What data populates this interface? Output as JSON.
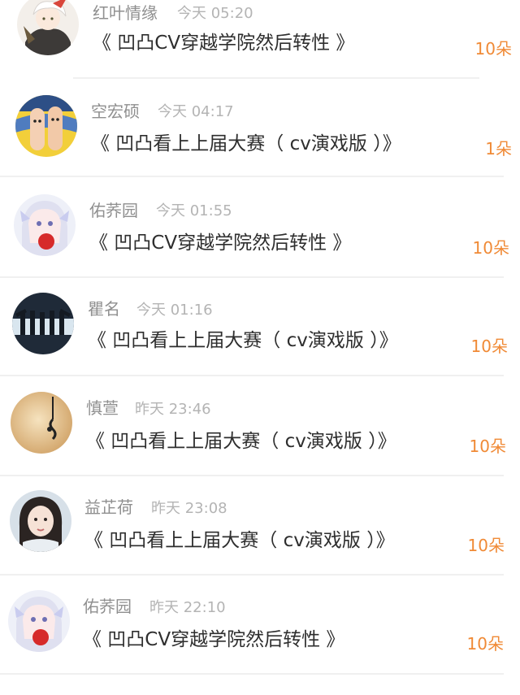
{
  "gift_list": [
    {
      "user": "红叶情缘",
      "time": "今天 05:20",
      "title": "《 凹凸CV穿越学院然后转性 》",
      "count": "10朵",
      "avatar": "white-haired-character-avatar"
    },
    {
      "user": "空宏硕",
      "time": "今天 04:17",
      "title": "《 凹凸看上上届大赛（ cv演戏版 ）》",
      "count": "1朵",
      "avatar": "finger-faces-avatar"
    },
    {
      "user": "佑荞园",
      "time": "今天 01:55",
      "title": "《 凹凸CV穿越学院然后转性 》",
      "count": "10朵",
      "avatar": "anime-girl-apple-avatar"
    },
    {
      "user": "瞿名",
      "time": "今天 01:16",
      "title": "《 凹凸看上上届大赛（ cv演戏版 ）》",
      "count": "10朵",
      "avatar": "silhouette-group-avatar"
    },
    {
      "user": "慎萱",
      "time": "昨天 23:46",
      "title": "《 凹凸看上上届大赛（ cv演戏版 ）》",
      "count": "10朵",
      "avatar": "music-note-avatar"
    },
    {
      "user": "益芷荷",
      "time": "昨天 23:08",
      "title": "《 凹凸看上上届大赛（ cv演戏版 ）》",
      "count": "10朵",
      "avatar": "girl-portrait-avatar"
    },
    {
      "user": "佑荞园",
      "time": "昨天 22:10",
      "title": "《 凹凸CV穿越学院然后转性 》",
      "count": "10朵",
      "avatar": "anime-girl-apple-avatar"
    }
  ],
  "colors": {
    "username": "#8f8f8f",
    "time": "#b4b4b4",
    "title": "#2e2e2e",
    "count": "#f08a36",
    "divider": "#f0f0f0"
  }
}
